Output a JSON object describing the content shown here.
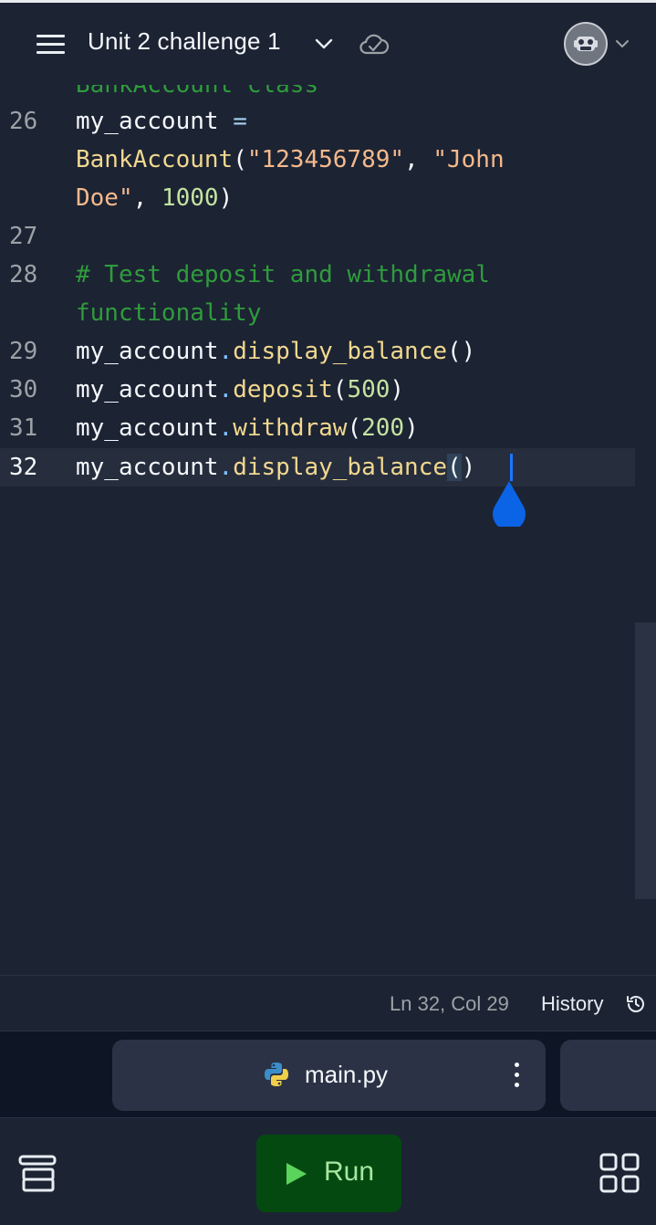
{
  "header": {
    "title": "Unit 2 challenge 1",
    "menu_icon": "hamburger-icon",
    "title_dropdown_icon": "chevron-down-icon",
    "sync_icon": "cloud-check-icon",
    "avatar_icon": "user-avatar",
    "avatar_dropdown_icon": "chevron-down-icon"
  },
  "editor": {
    "partial_line": "BankAccount class",
    "lines": [
      {
        "number": "26"
      },
      {
        "number": "27"
      },
      {
        "number": "28"
      },
      {
        "number": "29"
      },
      {
        "number": "30"
      },
      {
        "number": "31"
      },
      {
        "number": "32"
      }
    ],
    "code": {
      "l26_var": "my_account",
      "l26_op": " =",
      "l26b_cls": "BankAccount",
      "l26b_open": "(",
      "l26b_str1": "\"123456789\"",
      "l26b_comma": ", ",
      "l26b_str2a": "\"John",
      "l26c_str2b": "Doe\"",
      "l26c_comma": ", ",
      "l26c_num": "1000",
      "l26c_close": ")",
      "l28_comment_a": "# Test deposit and withdrawal",
      "l28_comment_b": "functionality",
      "l29_var": "my_account",
      "l29_dot": ".",
      "l29_fn": "display_balance",
      "l29_args": "()",
      "l30_var": "my_account",
      "l30_dot": ".",
      "l30_fn": "deposit",
      "l30_open": "(",
      "l30_num": "500",
      "l30_close": ")",
      "l31_var": "my_account",
      "l31_dot": ".",
      "l31_fn": "withdraw",
      "l31_open": "(",
      "l31_num": "200",
      "l31_close": ")",
      "l32_var": "my_account",
      "l32_dot": ".",
      "l32_fn": "display_balance",
      "l32_open": "(",
      "l32_close": ")"
    }
  },
  "status": {
    "cursor_position": "Ln 32, Col 29",
    "history_label": "History",
    "history_icon": "history-icon"
  },
  "tabs": {
    "active_file": "main.py",
    "file_icon": "python-icon",
    "more_icon": "kebab-menu-icon"
  },
  "bottom": {
    "run_label": "Run",
    "run_icon": "play-icon",
    "layers_icon": "layers-icon",
    "grid_icon": "grid-icon"
  },
  "colors": {
    "background": "#1c2333",
    "run_button": "#044a10",
    "caret": "#1e76ff"
  }
}
